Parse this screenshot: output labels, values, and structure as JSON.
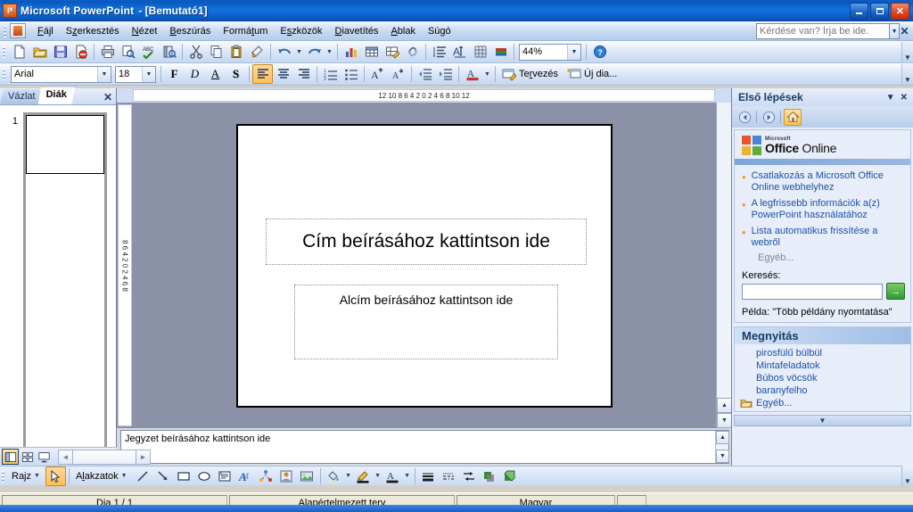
{
  "window": {
    "app_title": "Microsoft PowerPoint",
    "document_title": "- [Bemutató1]",
    "icon": "powerpoint-icon",
    "minimize_label": "_",
    "restore_label": "❐",
    "close_label": "✕"
  },
  "menubar": {
    "items": [
      {
        "label": "Fájl"
      },
      {
        "label": "Szerkesztés"
      },
      {
        "label": "Nézet"
      },
      {
        "label": "Beszúrás"
      },
      {
        "label": "Formátum"
      },
      {
        "label": "Eszközök"
      },
      {
        "label": "Diavetítés"
      },
      {
        "label": "Ablak"
      },
      {
        "label": "Súgó"
      }
    ],
    "ask_box": {
      "placeholder": "Kérdése van? Írja be ide.",
      "value": "",
      "close_label": "✕"
    }
  },
  "standard_toolbar": {
    "zoom_value": "44%",
    "buttons": [
      "new-icon",
      "open-icon",
      "save-icon",
      "permission-icon",
      "print-icon",
      "print-preview-icon",
      "spelling-icon",
      "research-icon",
      "cut-icon",
      "copy-icon",
      "paste-icon",
      "format-painter-icon",
      "undo-icon",
      "redo-icon",
      "chart-icon",
      "table-icon",
      "table-draw-icon",
      "hyperlink-icon",
      "expand-all-icon",
      "show-formatting-icon",
      "grid-icon",
      "color-scheme-icon",
      "zoom-combo",
      "help-icon"
    ]
  },
  "formatting_toolbar": {
    "font_name": "Arial",
    "font_size": "18",
    "bold_label": "F",
    "italic_label": "D",
    "underline_label": "A",
    "shadow_label": "S",
    "design_label": "Tervezés",
    "newslide_label": "Új dia..."
  },
  "left_panel": {
    "tabs": [
      {
        "label": "Vázlat",
        "active": false
      },
      {
        "label": "Diák",
        "active": true
      }
    ],
    "close_label": "✕",
    "slides": [
      {
        "number": "1"
      }
    ]
  },
  "rulers": {
    "horizontal": "12   10   8   6   4   2   0   2   4   6   8   10   12",
    "vertical": "8   6   4   2   0   2   4   6   8"
  },
  "slide": {
    "title_placeholder": "Cím beírásához kattintson ide",
    "subtitle_placeholder": "Alcím beírásához kattintson ide"
  },
  "notes": {
    "placeholder": "Jegyzet beírásához kattintson ide"
  },
  "task_pane": {
    "title": "Első lépések",
    "dropdown_label": "▼",
    "close_label": "✕",
    "nav": {
      "back_label": "◄",
      "forward_label": "►",
      "home_label": "home-icon"
    },
    "logo": {
      "microsoft": "Microsoft",
      "office": "Office",
      "online": "Online"
    },
    "links": [
      "Csatlakozás a Microsoft Office Online webhelyhez",
      "A legfrissebb információk a(z) PowerPoint használatához",
      "Lista automatikus frissítése a webről"
    ],
    "more_label": "Egyéb...",
    "search": {
      "label": "Keresés:",
      "value": "",
      "go_label": "→",
      "example": "Példa: \"Több példány nyomtatása\""
    },
    "open_section": {
      "header": "Megnyitás",
      "files": [
        "pirosfülű bülbül",
        "Mintafeladatok",
        "Búbos vöcsök",
        "baranyfelho"
      ],
      "more_label": "Egyéb..."
    },
    "scroll_down_label": "▼"
  },
  "view_bar": {
    "buttons": [
      {
        "name": "normal-view",
        "active": true
      },
      {
        "name": "slide-sorter-view",
        "active": false
      },
      {
        "name": "slide-show-view",
        "active": false
      }
    ],
    "prev_label": "◄",
    "next_label": "►"
  },
  "drawing_toolbar": {
    "draw_label": "Rajz",
    "autoshapes_label": "Alakzatok",
    "tools": [
      "select-arrow-icon",
      "line-icon",
      "arrow-icon",
      "rectangle-icon",
      "oval-icon",
      "textbox-icon",
      "wordart-icon",
      "diagram-icon",
      "clipart-icon",
      "picture-icon",
      "fill-color-icon",
      "line-color-icon",
      "font-color-icon",
      "line-style-icon",
      "dash-style-icon",
      "arrow-style-icon",
      "shadow-icon",
      "3d-icon"
    ]
  },
  "status_bar": {
    "slide_info": "Dia 1 / 1",
    "design": "Alapértelmezett terv",
    "language": "Magyar"
  },
  "colors": {
    "title_bar": "#0a57bb",
    "toolbar": "#c6d7f0",
    "workspace": "#8b92a8",
    "task_pane": "#e8eef9",
    "status_bar": "#ece9d8",
    "link": "#1b50a8",
    "accent_orange": "#f0972a"
  }
}
